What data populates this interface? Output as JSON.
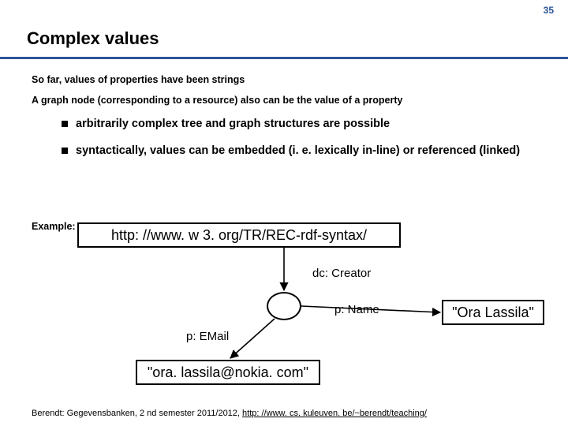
{
  "page_number": "35",
  "title": "Complex values",
  "intro_line_1": "So far, values of properties have been strings",
  "intro_line_2": "A graph node (corresponding to a resource) also can be the value of a property",
  "bullets": [
    "arbitrarily complex tree and graph structures are possible",
    "syntactically, values can be embedded (i. e. lexically in-line) or referenced (linked)"
  ],
  "example_label": "Example:",
  "diagram": {
    "root_uri": "http: //www. w 3. org/TR/REC-rdf-syntax/",
    "edge_creator": "dc: Creator",
    "edge_name": "p: Name",
    "edge_email": "p: EMail",
    "value_name": "\"Ora Lassila\"",
    "value_email": "\"ora. lassila@nokia. com\""
  },
  "footer": {
    "prefix": "Berendt: Gegevensbanken, 2 nd semester 2011/2012, ",
    "link_text": "http: //www. cs. kuleuven. be/~berendt/teaching/",
    "link_href": "http://www.cs.kuleuven.be/~berendt/teaching/"
  }
}
